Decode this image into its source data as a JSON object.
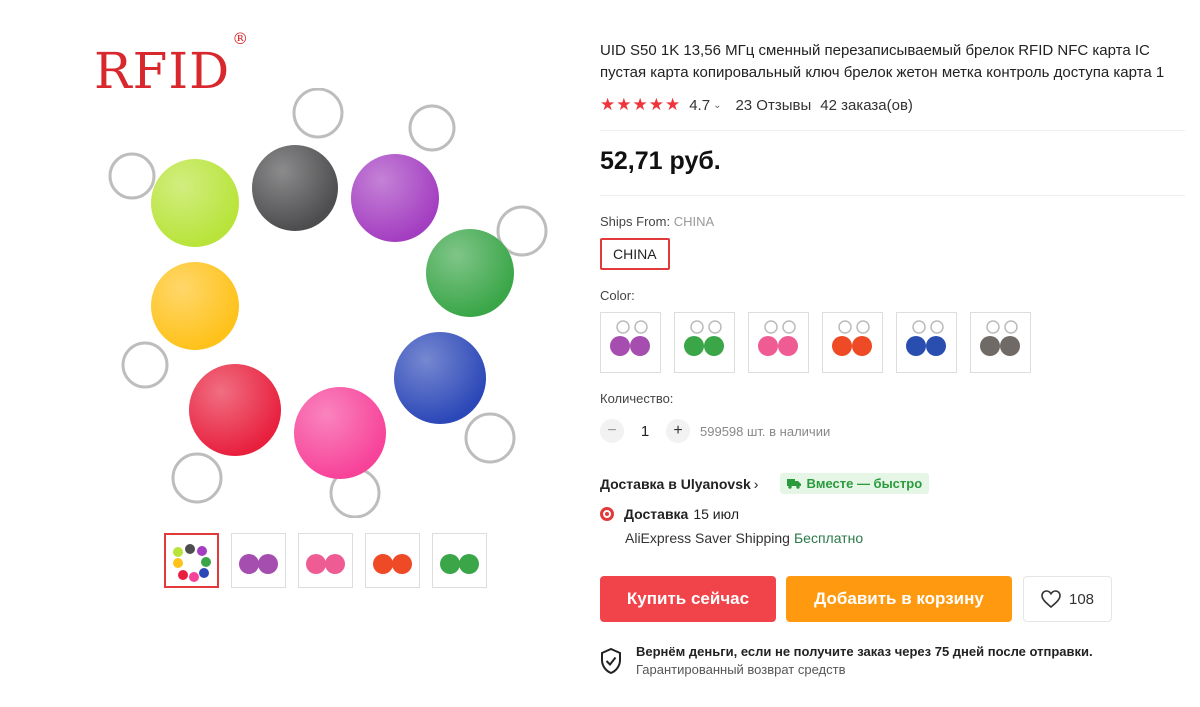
{
  "logo": {
    "text": "RFID",
    "mark": "®"
  },
  "product": {
    "title": "UID S50 1K 13,56 МГц сменный перезаписываемый брелок RFID NFC карта IC пустая карта копировальный ключ брелок жетон метка контроль доступа карта 1",
    "stars": "★★★★★",
    "rating": "4.7",
    "reviews": "23 Отзывы",
    "orders": "42 заказа(ов)",
    "price": "52,71 руб."
  },
  "ships_from": {
    "label": "Ships From:",
    "value": "CHINA",
    "option": "CHINA"
  },
  "color": {
    "label": "Color:",
    "swatches": [
      {
        "color": "#a64db0"
      },
      {
        "color": "#3aa648"
      },
      {
        "color": "#ee5c93"
      },
      {
        "color": "#ee4a26"
      },
      {
        "color": "#2a4db0"
      },
      {
        "color": "#6f6a66"
      }
    ]
  },
  "quantity": {
    "label": "Количество:",
    "minus": "−",
    "value": "1",
    "plus": "+",
    "stock": "599598 шт. в наличии"
  },
  "delivery": {
    "to": "Доставка в Ulyanovsk",
    "badge": "Вместе — быстро",
    "label": "Доставка",
    "date": "15 июл",
    "service": "AliExpress Saver Shipping",
    "cost": "Бесплатно"
  },
  "actions": {
    "buy": "Купить сейчас",
    "cart": "Добавить в корзину",
    "wishes": "108"
  },
  "guarantee": {
    "title": "Вернём деньги, если не получите заказ через 75 дней после отправки.",
    "subtitle": "Гарантированный возврат средств"
  },
  "colors": {
    "accent": "#f1444a",
    "cart": "#ff9a10",
    "free": "#2a7a4a"
  }
}
